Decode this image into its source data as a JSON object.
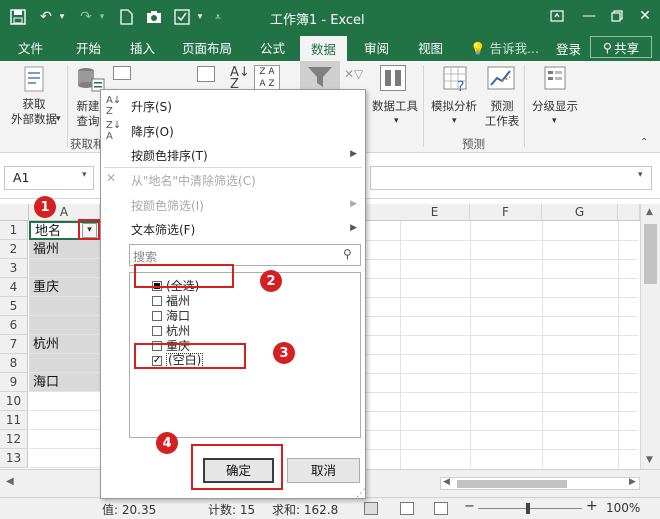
{
  "window": {
    "title": "工作簿1 - Excel",
    "accent": "#217346",
    "quick_access": [
      "save-icon",
      "undo-icon",
      "redo-icon",
      "new-file-icon",
      "camera-icon",
      "form-icon",
      "qat-more-icon"
    ],
    "controls": [
      "ribbon-options-icon",
      "minimize-icon",
      "restore-icon",
      "close-icon"
    ]
  },
  "tabs": [
    {
      "label": "文件"
    },
    {
      "label": "开始"
    },
    {
      "label": "插入"
    },
    {
      "label": "页面布局"
    },
    {
      "label": "公式"
    },
    {
      "label": "数据",
      "active": true
    },
    {
      "label": "审阅"
    },
    {
      "label": "视图"
    }
  ],
  "tell_me": "告诉我...",
  "login": "登录",
  "share": "共享",
  "ribbon": {
    "get_external": "获取\n外部数据",
    "new_query": "新建\n查询",
    "get_transform_group": "获取和",
    "data_tools": "数据工具",
    "what_if": "模拟分析",
    "forecast_sheet": "预测\n工作表",
    "forecast_group": "预测",
    "outline": "分级显示"
  },
  "namebox": "A1",
  "columns": [
    "A",
    "E",
    "F",
    "G"
  ],
  "rows": [
    {
      "num": "1",
      "value": "地名"
    },
    {
      "num": "2",
      "value": "福州"
    },
    {
      "num": "3",
      "value": ""
    },
    {
      "num": "4",
      "value": "重庆"
    },
    {
      "num": "5",
      "value": ""
    },
    {
      "num": "6",
      "value": ""
    },
    {
      "num": "7",
      "value": "杭州"
    },
    {
      "num": "8",
      "value": ""
    },
    {
      "num": "9",
      "value": "海口"
    },
    {
      "num": "10",
      "value": ""
    },
    {
      "num": "11",
      "value": ""
    },
    {
      "num": "12",
      "value": ""
    },
    {
      "num": "13",
      "value": ""
    }
  ],
  "filter_menu": {
    "sort_asc": "升序(S)",
    "sort_desc": "降序(O)",
    "sort_by_color": "按颜色排序(T)",
    "clear_filter": "从\"地名\"中清除筛选(C)",
    "filter_by_color": "按颜色筛选(I)",
    "text_filter": "文本筛选(F)",
    "search_placeholder": "搜索",
    "items": [
      {
        "label": "(全选)",
        "state": "partial"
      },
      {
        "label": "福州",
        "state": "unchecked"
      },
      {
        "label": "海口",
        "state": "unchecked"
      },
      {
        "label": "杭州",
        "state": "unchecked"
      },
      {
        "label": "重庆",
        "state": "unchecked"
      },
      {
        "label": "(空白)",
        "state": "checked"
      }
    ],
    "ok": "确定",
    "cancel": "取消"
  },
  "annotations": [
    "1",
    "2",
    "3",
    "4"
  ],
  "status": {
    "value": "值: 20.35",
    "count": "计数: 15",
    "sum": "求和: 162.8",
    "zoom": "100%"
  }
}
